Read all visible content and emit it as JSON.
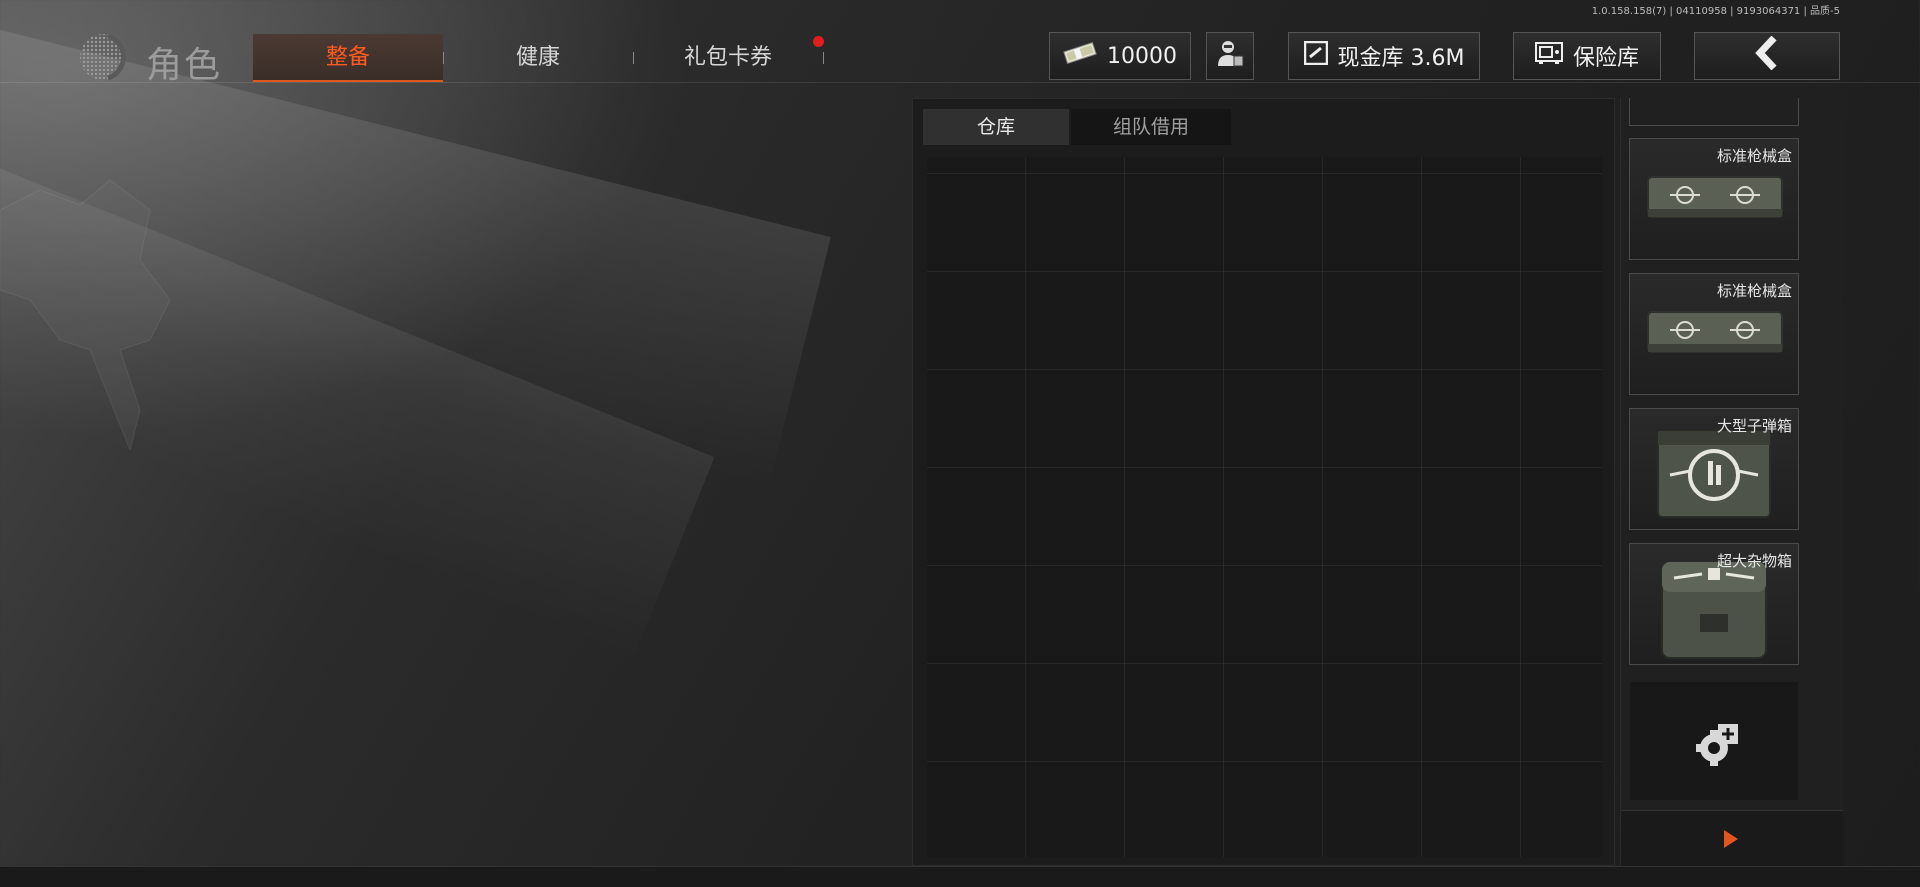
{
  "version_info": "1.0.158.158(7) | 04110958 | 9193064371 | 品质-5",
  "header": {
    "title": "角色",
    "tabs": [
      {
        "label": "整备",
        "active": true
      },
      {
        "label": "健康",
        "active": false
      },
      {
        "label": "礼包卡券",
        "active": false,
        "notification": true
      }
    ],
    "currency": {
      "icon": "cash-icon",
      "value": "10000"
    },
    "profile_icon": "operator-avatar-icon",
    "cash_vault": {
      "icon": "cash-vault-icon",
      "label": "现金库 3.6M"
    },
    "safe_vault": {
      "icon": "safe-icon",
      "label": "保险库"
    },
    "back_icon": "chevron-left-icon"
  },
  "inventory": {
    "tabs": [
      {
        "label": "仓库",
        "selected": true
      },
      {
        "label": "组队借用",
        "selected": false
      }
    ]
  },
  "containers": [
    {
      "label": "标准枪械盒",
      "icon": "weapon-case-icon"
    },
    {
      "label": "标准枪械盒",
      "icon": "weapon-case-icon"
    },
    {
      "label": "大型子弹箱",
      "icon": "ammo-box-icon"
    },
    {
      "label": "超大杂物箱",
      "icon": "supply-crate-icon"
    }
  ],
  "add_container_icon": "add-container-icon",
  "next_icon": "arrow-right-icon",
  "colors": {
    "accent": "#e2551f",
    "notification": "#e01e1e",
    "panel_bg": "#1b1c1b"
  }
}
